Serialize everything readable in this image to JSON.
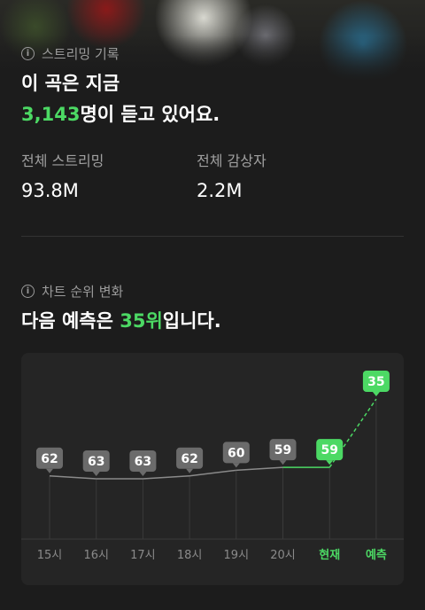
{
  "streaming": {
    "section_title": "스트리밍 기록",
    "headline_line1": "이 곡은 지금",
    "listeners_now": "3,143",
    "headline_suffix": "명이 듣고 있어요.",
    "total_streams_label": "전체 스트리밍",
    "total_streams_value": "93.8M",
    "total_listeners_label": "전체 감상자",
    "total_listeners_value": "2.2M"
  },
  "chart_section": {
    "section_title": "차트 순위 변화",
    "headline_prefix": "다음 예측은 ",
    "predicted_rank": "35위",
    "headline_suffix": "입니다."
  },
  "colors": {
    "accent": "#4cd964",
    "badge": "#6b6b6b",
    "background": "#1c1c1c",
    "card": "#252525"
  },
  "chart_data": {
    "type": "line",
    "categories": [
      "15시",
      "16시",
      "17시",
      "18시",
      "19시",
      "20시",
      "현재",
      "예측"
    ],
    "values": [
      62,
      63,
      63,
      62,
      60,
      59,
      59,
      35
    ],
    "highlight_indices": [
      6,
      7
    ],
    "predicted_index": 7,
    "y_inverted": true,
    "grid": "vertical"
  }
}
